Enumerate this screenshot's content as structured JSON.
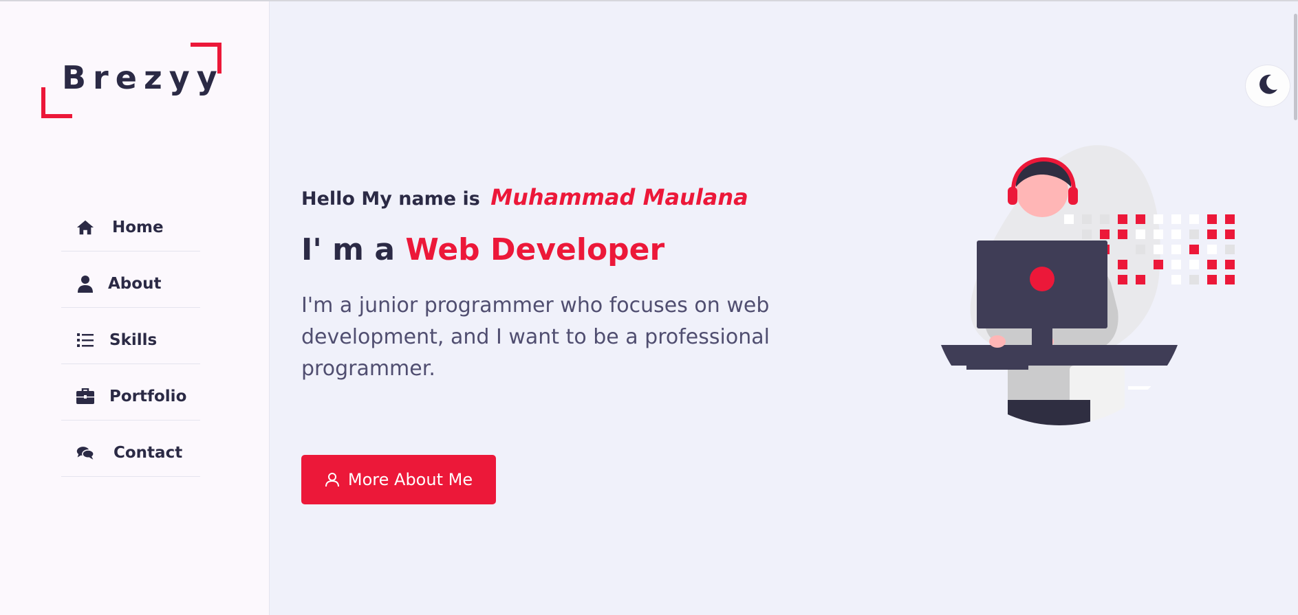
{
  "logo": {
    "text": "Brezyy"
  },
  "nav": {
    "items": [
      {
        "label": "Home",
        "icon": "home-icon"
      },
      {
        "label": "About",
        "icon": "user-icon"
      },
      {
        "label": "Skills",
        "icon": "list-icon"
      },
      {
        "label": "Portfolio",
        "icon": "briefcase-icon"
      },
      {
        "label": "Contact",
        "icon": "comments-icon"
      }
    ]
  },
  "hero": {
    "greeting": "Hello My name is",
    "name": "Muhammad  Maulana",
    "role_prefix": "I' m a",
    "role": "Web Developer",
    "description": "I'm a junior programmer who focuses on web development, and I want to be a professional programmer.",
    "button_label": "More About Me"
  },
  "theme_toggle": {
    "icon": "moon-icon"
  },
  "colors": {
    "accent": "#ec1839",
    "text_dark": "#2b2a45",
    "sidebar_bg": "#fcf8fd",
    "main_bg": "#f0f1fa"
  }
}
